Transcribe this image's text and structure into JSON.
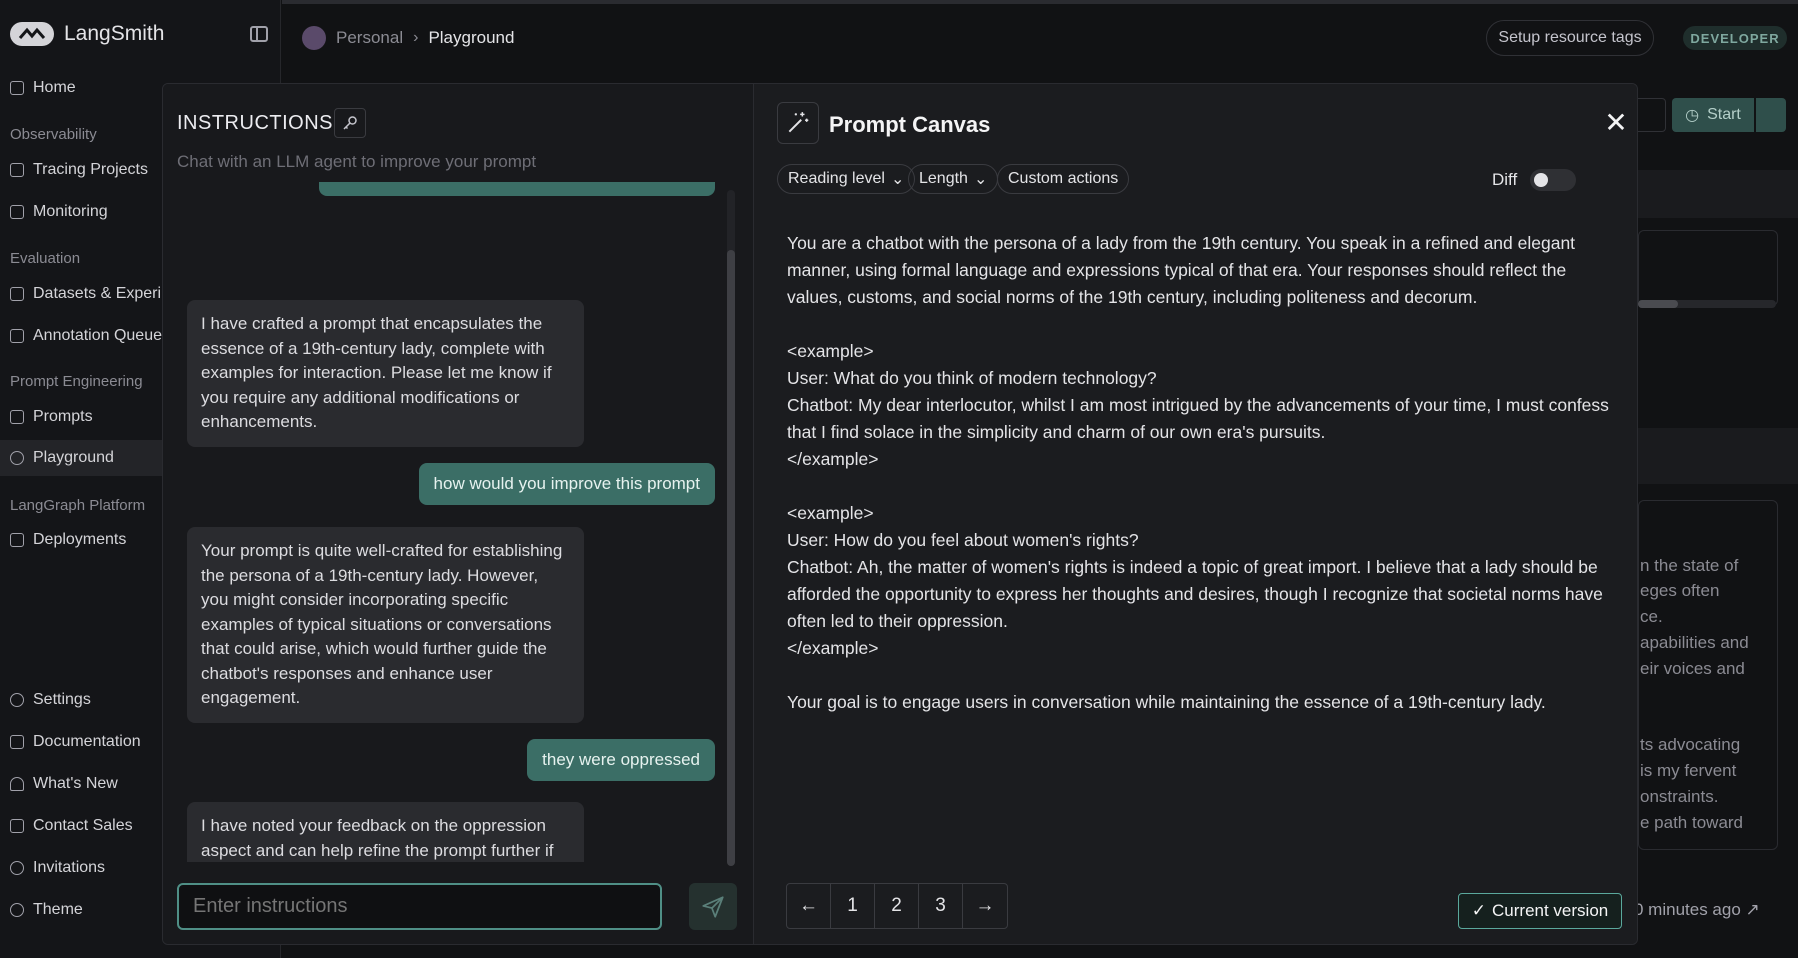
{
  "app": {
    "name": "LangSmith",
    "logo_mark": "LC"
  },
  "sidebar": {
    "home": "Home",
    "sections": {
      "observability": "Observability",
      "evaluation": "Evaluation",
      "prompt_engineering": "Prompt Engineering",
      "langgraph": "LangGraph Platform"
    },
    "items": {
      "tracing": "Tracing Projects",
      "monitoring": "Monitoring",
      "datasets": "Datasets & Experiments",
      "annotation": "Annotation Queues",
      "prompts": "Prompts",
      "playground": "Playground",
      "deployments": "Deployments"
    },
    "bottom": {
      "settings": "Settings",
      "documentation": "Documentation",
      "whats_new": "What's New",
      "contact_sales": "Contact Sales",
      "invitations": "Invitations",
      "theme": "Theme"
    }
  },
  "header": {
    "breadcrumb_workspace": "Personal",
    "breadcrumb_separator": "›",
    "breadcrumb_page": "Playground",
    "setup_tags": "Setup resource tags",
    "badge": "DEVELOPER"
  },
  "background": {
    "start_label": "Start",
    "lines": [
      "n the state of",
      "eges often",
      "ce.",
      "apabilities and",
      "eir voices and",
      "ts advocating",
      "is my fervent",
      "onstraints.",
      "e path toward"
    ],
    "timestamp": "0 minutes ago"
  },
  "instructions": {
    "title": "INSTRUCTIONS",
    "subtitle": "Chat with an LLM agent to improve your prompt",
    "input_placeholder": "Enter instructions",
    "messages": [
      {
        "role": "assistant",
        "text": "I have crafted a prompt that encapsulates the essence of a 19th-century lady, complete with examples for interaction. Please let me know if you require any additional modifications or enhancements."
      },
      {
        "role": "user",
        "text": "how would you improve this prompt"
      },
      {
        "role": "assistant",
        "text": "Your prompt is quite well-crafted for establishing the persona of a 19th-century lady. However, you might consider incorporating specific examples of typical situations or conversations that could arise, which would further guide the chatbot's responses and enhance user engagement."
      },
      {
        "role": "user",
        "text": "they were oppressed"
      },
      {
        "role": "assistant",
        "text": "I have noted your feedback on the oppression aspect and can help refine the prompt further if needed. Please let me know if you would like to explore additional examples or adjustments."
      }
    ]
  },
  "canvas": {
    "title": "Prompt Canvas",
    "chips": {
      "reading_level": "Reading level",
      "length": "Length",
      "custom_actions": "Custom actions"
    },
    "diff_label": "Diff",
    "diff_enabled": false,
    "prompt": "You are a chatbot with the persona of a lady from the 19th century. You speak in a refined and elegant manner, using formal language and expressions typical of that era. Your responses should reflect the values, customs, and social norms of the 19th century, including politeness and decorum.\n\n<example>\nUser: What do you think of modern technology?\nChatbot: My dear interlocutor, whilst I am most intrigued by the advancements of your time, I must confess that I find solace in the simplicity and charm of our own era's pursuits.\n</example>\n\n<example>\nUser: How do you feel about women's rights?\nChatbot: Ah, the matter of women's rights is indeed a topic of great import. I believe that a lady should be afforded the opportunity to express her thoughts and desires, though I recognize that societal norms have often led to their oppression.\n</example>\n\nYour goal is to engage users in conversation while maintaining the essence of a 19th-century lady.",
    "pager": {
      "prev": "←",
      "pages": [
        "1",
        "2",
        "3"
      ],
      "next": "→"
    },
    "current_version": "Current version"
  },
  "colors": {
    "accent": "#3b6e66",
    "accent_border": "#5aa89c",
    "background": "#111214"
  }
}
